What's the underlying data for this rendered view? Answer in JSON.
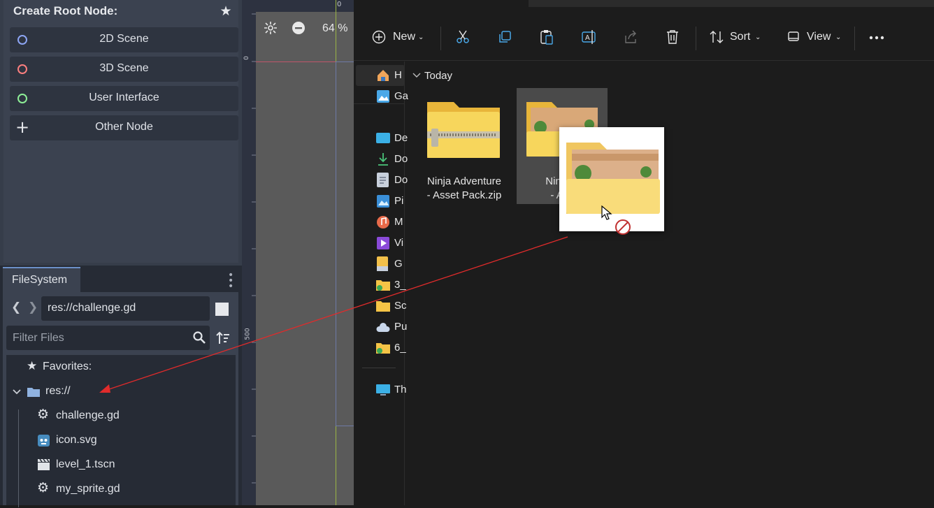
{
  "godot": {
    "create_root": {
      "title": "Create Root Node:",
      "buttons": [
        {
          "label": "2D Scene",
          "ring_color": "#8da5f3"
        },
        {
          "label": "3D Scene",
          "ring_color": "#fc7f7f"
        },
        {
          "label": "User Interface",
          "ring_color": "#8eef97"
        },
        {
          "label": "Other Node"
        }
      ]
    },
    "filesystem": {
      "tab_label": "FileSystem",
      "path": "res://challenge.gd",
      "filter_placeholder": "Filter Files",
      "tree": [
        {
          "label": "Favorites:",
          "icon": "star-icon"
        },
        {
          "label": "res://",
          "icon": "folder-icon"
        },
        {
          "label": "challenge.gd",
          "icon": "gear-icon"
        },
        {
          "label": "icon.svg",
          "icon": "godot-logo-icon"
        },
        {
          "label": "level_1.tscn",
          "icon": "clapperboard-icon"
        },
        {
          "label": "my_sprite.gd",
          "icon": "gear-icon"
        }
      ]
    },
    "viewport": {
      "zoom": "64 %",
      "ruler_top": "0",
      "ruler_left_0": "0",
      "ruler_left_500": "500"
    }
  },
  "explorer": {
    "toolbar": {
      "new_label": "New",
      "sort_label": "Sort",
      "view_label": "View"
    },
    "nav": [
      "H",
      "Ga",
      "De",
      "Do",
      "Do",
      "Pi",
      "M",
      "Vi",
      "G",
      "3_",
      "Sc",
      "Pu",
      "6_",
      "Th"
    ],
    "group_header": "Today",
    "files": [
      {
        "name_line1": "Ninja Adventure",
        "name_line2": "- Asset Pack.zip"
      },
      {
        "name_line1": "Ninja A",
        "name_line2": "- Ass"
      }
    ]
  },
  "colors": {
    "accent_blue": "#6b90c8",
    "drag_arrow": "#e02b2b"
  }
}
